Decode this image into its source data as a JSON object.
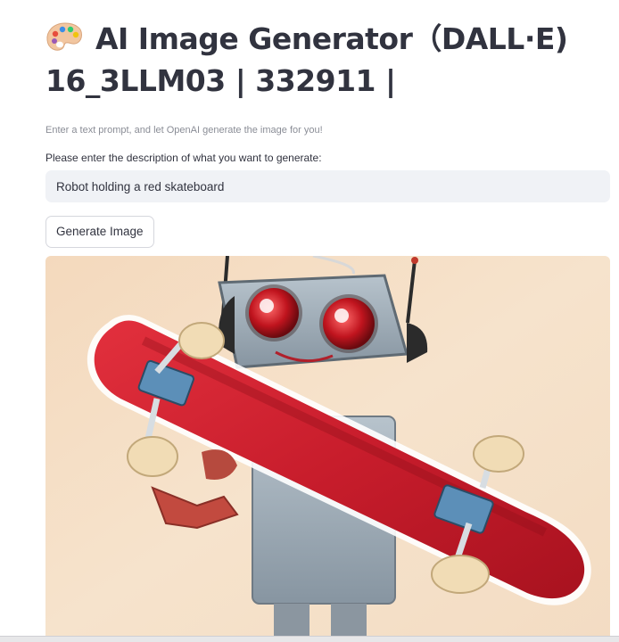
{
  "app": {
    "title": "AI Image Generator（DALL·E) 16_3LLM03 | 332911 |",
    "emoji_icon": "artist-palette-icon",
    "caption": "Enter a text prompt, and let OpenAI generate the image for you!"
  },
  "prompt": {
    "label": "Please enter the description of what you want to generate:",
    "value": "Robot holding a red skateboard"
  },
  "actions": {
    "generate_label": "Generate Image"
  },
  "colors": {
    "input_bg": "#f0f2f6",
    "text": "#31333f",
    "caption": "#8a8d96",
    "skateboard_red": "#c81d2c"
  }
}
